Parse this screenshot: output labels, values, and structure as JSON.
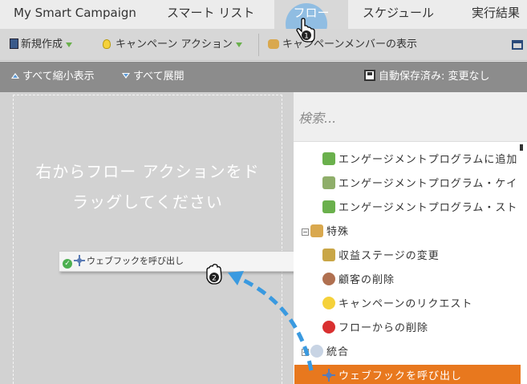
{
  "tabs": {
    "campaign": "My Smart Campaign",
    "smart_list": "スマート リスト",
    "flow": "フロー",
    "schedule": "スケジュール",
    "results": "実行結果"
  },
  "toolbar": {
    "new": "新規作成",
    "campaign_actions": "キャンペーン アクション",
    "show_members": "キャンペーンメンバーの表示"
  },
  "subtoolbar": {
    "collapse_all": "すべて縮小表示",
    "expand_all": "すべて展開",
    "autosave": "自動保存済み: 変更なし"
  },
  "canvas": {
    "drop_hint_line1": "右からフロー アクションをド",
    "drop_hint_line2": "ラッグしてください",
    "dragged_item": "ウェブフックを呼び出し"
  },
  "sidebar": {
    "search_placeholder": "検索...",
    "items": [
      {
        "label": "エンゲージメントプログラムに追加",
        "type": "item"
      },
      {
        "label": "エンゲージメントプログラム・ケイ",
        "type": "item"
      },
      {
        "label": "エンゲージメントプログラム・スト",
        "type": "item"
      },
      {
        "label": "特殊",
        "type": "group"
      },
      {
        "label": "収益ステージの変更",
        "type": "item"
      },
      {
        "label": "顧客の削除",
        "type": "item"
      },
      {
        "label": "キャンペーンのリクエスト",
        "type": "item"
      },
      {
        "label": "フローからの削除",
        "type": "item"
      },
      {
        "label": "統合",
        "type": "group"
      },
      {
        "label": "ウェブフックを呼び出し",
        "type": "item",
        "selected": true
      }
    ]
  },
  "cursor_labels": {
    "first": "1",
    "second": "2"
  },
  "colors": {
    "accent": "#e8781e",
    "tab_bubble": "#78b4e6",
    "drag_arrow": "#3a9ae0"
  }
}
